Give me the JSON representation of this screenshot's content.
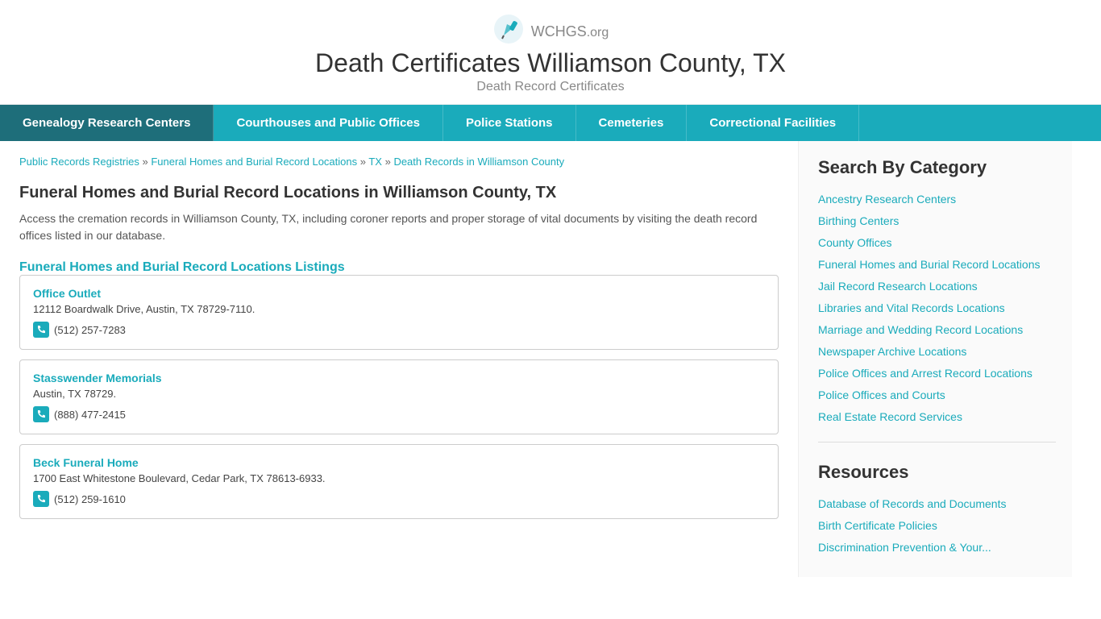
{
  "header": {
    "logo_text": "WCHGS",
    "logo_suffix": ".org",
    "site_title": "Death Certificates Williamson County, TX",
    "site_subtitle": "Death Record Certificates"
  },
  "nav": {
    "items": [
      {
        "label": "Genealogy Research Centers",
        "active": false
      },
      {
        "label": "Courthouses and Public Offices",
        "active": false
      },
      {
        "label": "Police Stations",
        "active": false
      },
      {
        "label": "Cemeteries",
        "active": false
      },
      {
        "label": "Correctional Facilities",
        "active": false
      }
    ]
  },
  "breadcrumb": {
    "links": [
      {
        "text": "Public Records Registries",
        "sep": "»"
      },
      {
        "text": "Funeral Homes and Burial Record Locations",
        "sep": "»"
      },
      {
        "text": "TX",
        "sep": "»"
      },
      {
        "text": "Death Records in Williamson County",
        "sep": ""
      }
    ]
  },
  "main": {
    "page_heading": "Funeral Homes and Burial Record Locations in Williamson County, TX",
    "page_desc": "Access the cremation records in Williamson County, TX, including coroner reports and proper storage of vital documents by visiting the death record offices listed in our database.",
    "listings_heading": "Funeral Homes and Burial Record Locations Listings",
    "locations": [
      {
        "name": "Office Outlet",
        "address": "12112 Boardwalk Drive, Austin, TX 78729-7110.",
        "phone": "(512) 257-7283"
      },
      {
        "name": "Stasswender Memorials",
        "address": "Austin, TX 78729.",
        "phone": "(888) 477-2415"
      },
      {
        "name": "Beck Funeral Home",
        "address": "1700 East Whitestone Boulevard, Cedar Park, TX 78613-6933.",
        "phone": "(512) 259-1610"
      }
    ]
  },
  "sidebar": {
    "category_title": "Search By Category",
    "category_links": [
      "Ancestry Research Centers",
      "Birthing Centers",
      "County Offices",
      "Funeral Homes and Burial Record Locations",
      "Jail Record Research Locations",
      "Libraries and Vital Records Locations",
      "Marriage and Wedding Record Locations",
      "Newspaper Archive Locations",
      "Police Offices and Arrest Record Locations",
      "Police Offices and Courts",
      "Real Estate Record Services"
    ],
    "resources_title": "Resources",
    "resource_links": [
      "Database of Records and Documents",
      "Birth Certificate Policies",
      "Discrimination Prevention & Your..."
    ]
  }
}
